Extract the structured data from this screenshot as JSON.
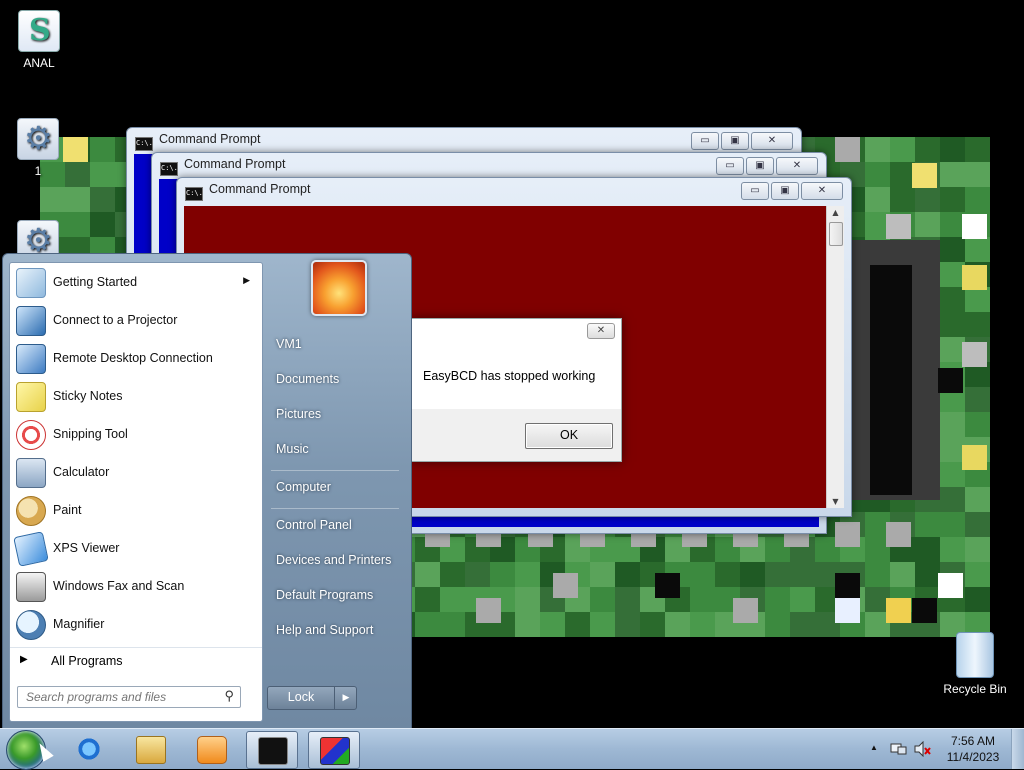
{
  "desktop": {
    "icons": [
      {
        "label": "ANAL"
      },
      {
        "label": "1"
      },
      {
        "label": ""
      },
      {
        "label": "Recycle Bin"
      }
    ]
  },
  "windows": {
    "cmd_title": "Command Prompt",
    "cmd_icon_text": "C:\\.",
    "minimize_glyph": "▭",
    "maximize_glyph": "▣",
    "close_glyph": "✕"
  },
  "dialog": {
    "message": "EasyBCD has stopped working",
    "ok_label": "OK",
    "close_glyph": "✕"
  },
  "start_menu": {
    "programs": [
      {
        "label": "Getting Started",
        "icon": "getting-started-icon",
        "has_submenu": true
      },
      {
        "label": "Connect to a Projector",
        "icon": "projector-icon"
      },
      {
        "label": "Remote Desktop Connection",
        "icon": "remote-desktop-icon"
      },
      {
        "label": "Sticky Notes",
        "icon": "sticky-notes-icon"
      },
      {
        "label": "Snipping Tool",
        "icon": "scissors-icon"
      },
      {
        "label": "Calculator",
        "icon": "calculator-icon"
      },
      {
        "label": "Paint",
        "icon": "paint-palette-icon"
      },
      {
        "label": "XPS Viewer",
        "icon": "xps-viewer-icon"
      },
      {
        "label": "Windows Fax and Scan",
        "icon": "fax-icon"
      },
      {
        "label": "Magnifier",
        "icon": "magnifier-icon"
      }
    ],
    "all_programs_label": "All Programs",
    "search_placeholder": "Search programs and files",
    "right_links": [
      "VM1",
      "Documents",
      "Pictures",
      "Music",
      "Computer",
      "Control Panel",
      "Devices and Printers",
      "Default Programs",
      "Help and Support"
    ],
    "shutdown_label": "Lock",
    "shutdown_arrow": "▶",
    "submenu_arrow": "▶",
    "search_icon_glyph": "⚲"
  },
  "taskbar": {
    "buttons": [
      {
        "name": "internet-explorer-icon"
      },
      {
        "name": "file-explorer-icon"
      },
      {
        "name": "media-player-icon"
      },
      {
        "name": "command-prompt-icon",
        "active": true
      },
      {
        "name": "easybcd-icon",
        "active": true
      }
    ],
    "tray_arrow": "▲",
    "clock_time": "7:56 AM",
    "clock_date": "11/4/2023"
  },
  "colors": {
    "console_background": "#800000",
    "wallpaper_green": "#2e7d32",
    "taskbar": "#9eb8d4"
  }
}
